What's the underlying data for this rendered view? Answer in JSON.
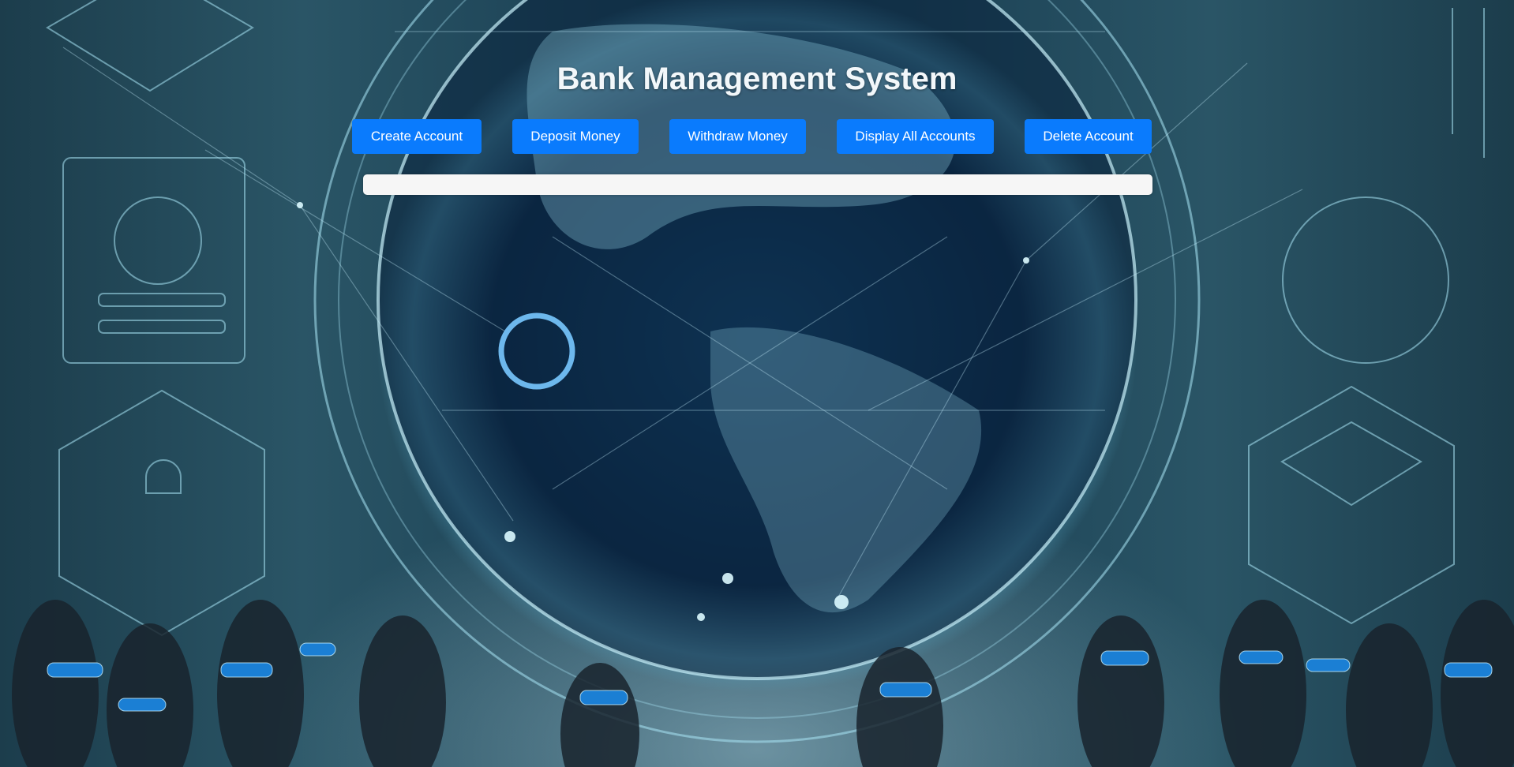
{
  "page": {
    "title": "Bank Management System"
  },
  "toolbar": {
    "buttons": [
      {
        "label": "Create Account"
      },
      {
        "label": "Deposit Money"
      },
      {
        "label": "Withdraw Money"
      },
      {
        "label": "Display All Accounts"
      },
      {
        "label": "Delete Account"
      }
    ]
  },
  "output": {
    "text": ""
  },
  "colors": {
    "button_bg": "#0a7bfd",
    "button_text": "#ffffff",
    "title_text": "#f2f7fa",
    "panel_bg": "#f6f6f6"
  },
  "background_image": {
    "icon": "digital-globe-network-image"
  }
}
